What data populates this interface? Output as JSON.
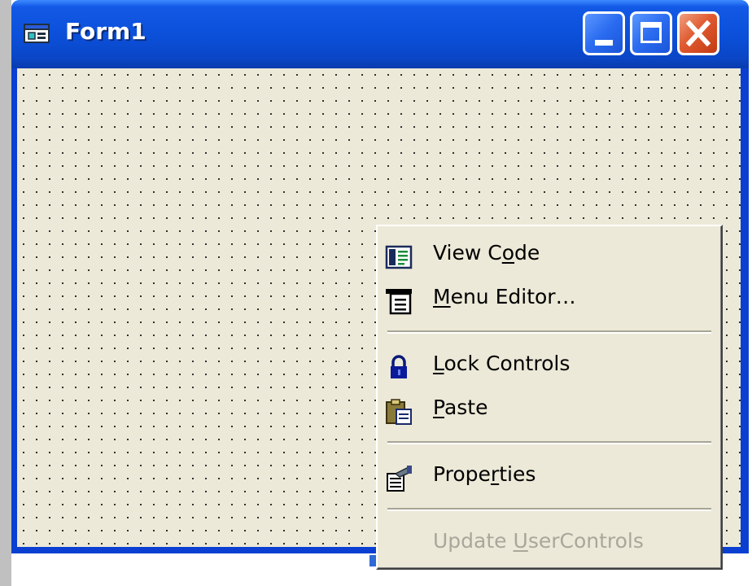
{
  "window": {
    "title": "Form1"
  },
  "context_menu": {
    "items": [
      {
        "pre": "View C",
        "key": "o",
        "post": "de",
        "icon": "code-window-icon",
        "enabled": true
      },
      {
        "pre": "",
        "key": "M",
        "post": "enu Editor…",
        "icon": "menu-editor-icon",
        "enabled": true
      },
      {
        "pre": "",
        "key": "L",
        "post": "ock Controls",
        "icon": "lock-icon",
        "enabled": true
      },
      {
        "pre": "",
        "key": "P",
        "post": "aste",
        "icon": "clipboard-paste-icon",
        "enabled": true
      },
      {
        "pre": "Prope",
        "key": "r",
        "post": "ties",
        "icon": "properties-icon",
        "enabled": true
      },
      {
        "pre": "Update ",
        "key": "U",
        "post": "serControls",
        "icon": "",
        "enabled": false
      }
    ]
  },
  "colors": {
    "titlebar": "#0b4fd8",
    "form_background": "#ece9d8",
    "close_button": "#e05a30",
    "disabled_text": "#a9a79b"
  }
}
